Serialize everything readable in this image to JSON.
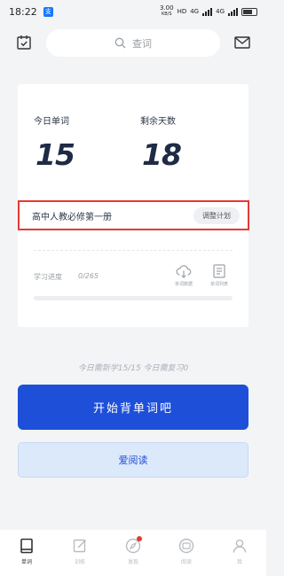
{
  "status_bar": {
    "time": "18:22",
    "app_badge": "支",
    "speed_value": "3.00",
    "speed_unit": "KB/S",
    "hd_label": "HD",
    "network_1": "4G",
    "network_2": "4G"
  },
  "header": {
    "search_placeholder": "查词",
    "calendar_icon": "calendar-check-icon",
    "mail_icon": "mail-icon"
  },
  "card": {
    "today_words_label": "今日单词",
    "today_words_value": "15",
    "days_left_label": "剩余天数",
    "days_left_value": "18",
    "plan_name": "高中人教必修第一册",
    "adjust_button": "调整计划",
    "progress_label": "学习进度",
    "progress_text": "0/265",
    "progress_fraction": 0,
    "tool_1_label": "单词数据",
    "tool_2_label": "单词列表"
  },
  "today_summary": "今日需新学15/15 今日需复习0",
  "start_button": "开始背单词吧",
  "reading_button": "爱阅读",
  "nav": {
    "items": [
      {
        "label": "单词",
        "icon": "book-icon"
      },
      {
        "label": "训练",
        "icon": "edit-icon"
      },
      {
        "label": "发现",
        "icon": "compass-icon"
      },
      {
        "label": "阅读",
        "icon": "reading-icon"
      },
      {
        "label": "我",
        "icon": "user-icon"
      }
    ]
  },
  "colors": {
    "accent": "#1e4fd9",
    "highlight_border": "#e53935",
    "notification_dot": "#e53935"
  }
}
